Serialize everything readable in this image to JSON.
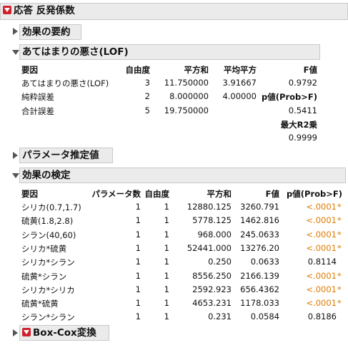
{
  "title": "応答 反発係数",
  "summary_title": "効果の要約",
  "lof": {
    "title": "あてはまりの悪さ(LOF)",
    "headers": [
      "要因",
      "自由度",
      "平方和",
      "平均平方",
      "F値"
    ],
    "rows": [
      [
        "あてはまりの悪さ(LOF)",
        "3",
        "11.750000",
        "3.91667",
        "0.9792"
      ],
      [
        "純粋誤差",
        "2",
        "8.000000",
        "4.00000",
        "p値(Prob>F)"
      ],
      [
        "合計誤差",
        "5",
        "19.750000",
        "",
        "0.5411"
      ]
    ],
    "maxr2_label": "最大R2乗",
    "maxr2_value": "0.9999"
  },
  "param_title": "パラメータ推定値",
  "effects": {
    "title": "効果の検定",
    "headers": [
      "要因",
      "パラメータ数",
      "自由度",
      "平方和",
      "F値",
      "p値(Prob>F)"
    ],
    "rows": [
      [
        "シリカ(0.7,1.7)",
        "1",
        "1",
        "12880.125",
        "3260.791",
        "<.0001",
        "*"
      ],
      [
        "硫黄(1.8,2.8)",
        "1",
        "1",
        "5778.125",
        "1462.816",
        "<.0001",
        "*"
      ],
      [
        "シラン(40,60)",
        "1",
        "1",
        "968.000",
        "245.0633",
        "<.0001",
        "*"
      ],
      [
        "シリカ*硫黄",
        "1",
        "1",
        "52441.000",
        "13276.20",
        "<.0001",
        "*"
      ],
      [
        "シリカ*シラン",
        "1",
        "1",
        "0.250",
        "0.0633",
        "0.8114",
        ""
      ],
      [
        "硫黄*シラン",
        "1",
        "1",
        "8556.250",
        "2166.139",
        "<.0001",
        "*"
      ],
      [
        "シリカ*シリカ",
        "1",
        "1",
        "2592.923",
        "656.4362",
        "<.0001",
        "*"
      ],
      [
        "硫黄*硫黄",
        "1",
        "1",
        "4653.231",
        "1178.033",
        "<.0001",
        "*"
      ],
      [
        "シラン*シラン",
        "1",
        "1",
        "0.231",
        "0.0584",
        "0.8186",
        ""
      ]
    ]
  },
  "boxcox_title": "Box-Cox変換",
  "colors": {
    "significant": "#e07b00",
    "header_bg": "#ebebeb",
    "menu_red": "#d0212b"
  }
}
